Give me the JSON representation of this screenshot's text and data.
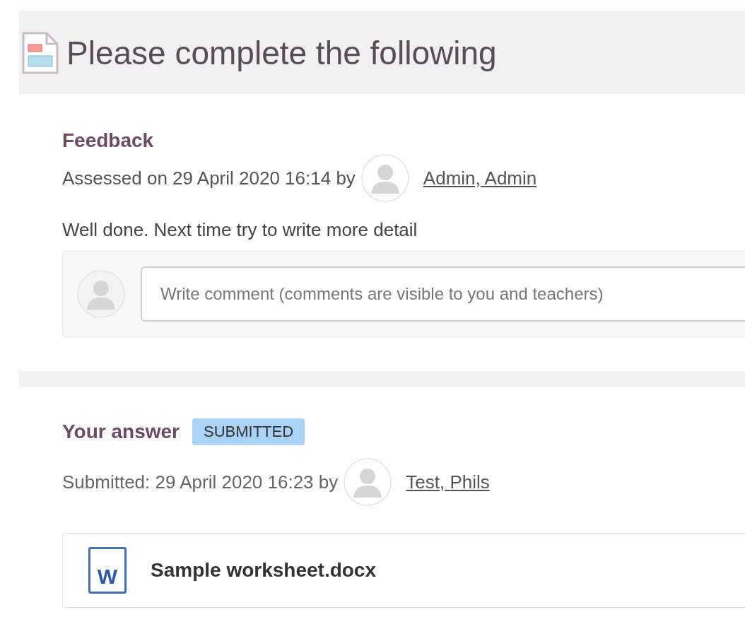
{
  "page": {
    "title": "Please complete the following"
  },
  "feedback": {
    "heading": "Feedback",
    "assessed_text": "Assessed on 29 April 2020 16:14 by",
    "assessor": "Admin, Admin",
    "message": "Well done. Next time try to write more detail",
    "comment": {
      "placeholder": "Write comment (comments are visible to you and teachers)"
    }
  },
  "answer": {
    "heading": "Your answer",
    "status": "SUBMITTED",
    "submitted_text": "Submitted: 29 April 2020 16:23 by",
    "submitter": "Test, Phils",
    "file": {
      "icon_letter": "W",
      "name": "Sample worksheet.docx"
    }
  }
}
